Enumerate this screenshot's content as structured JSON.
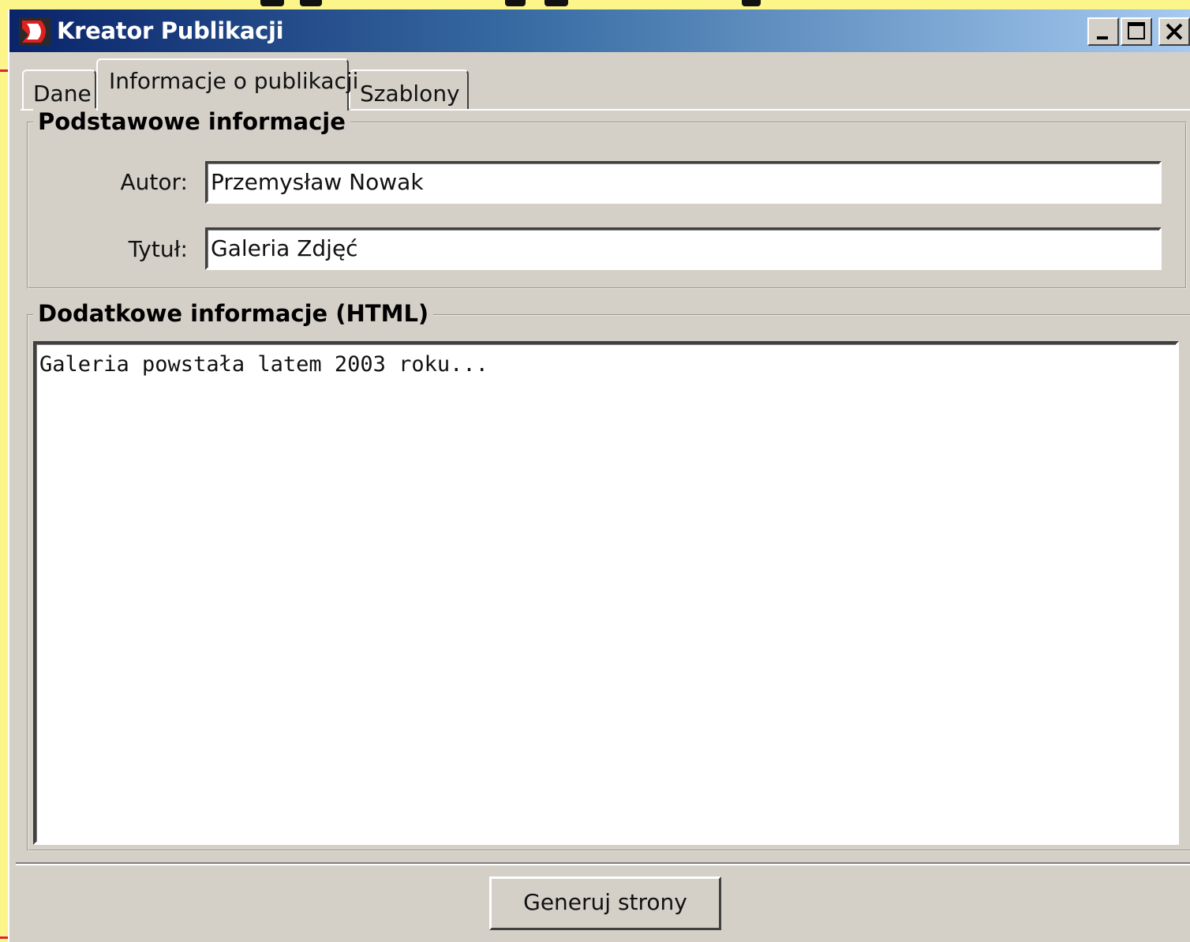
{
  "window": {
    "title": "Kreator Publikacji",
    "controls": {
      "minimize_icon": "minimize-icon",
      "maximize_icon": "maximize-icon",
      "close_icon": "close-icon"
    }
  },
  "tabs": [
    {
      "label": "Dane",
      "selected": false
    },
    {
      "label": "Informacje o publikacji",
      "selected": true
    },
    {
      "label": "Szablony",
      "selected": false
    }
  ],
  "basic_info": {
    "legend": "Podstawowe informacje",
    "author_label": "Autor:",
    "author_value": "Przemysław Nowak",
    "title_label": "Tytuł:",
    "title_value": "Galeria Zdjęć"
  },
  "extra_info": {
    "legend": "Dodatkowe informacje (HTML)",
    "content": "Galeria powstała latem 2003 roku..."
  },
  "footer": {
    "generate_label": "Generuj strony"
  },
  "colors": {
    "face": "#d4d0c8",
    "title_start": "#0a246a",
    "title_end": "#a6caf0",
    "slide_bg": "#fcf58a"
  }
}
